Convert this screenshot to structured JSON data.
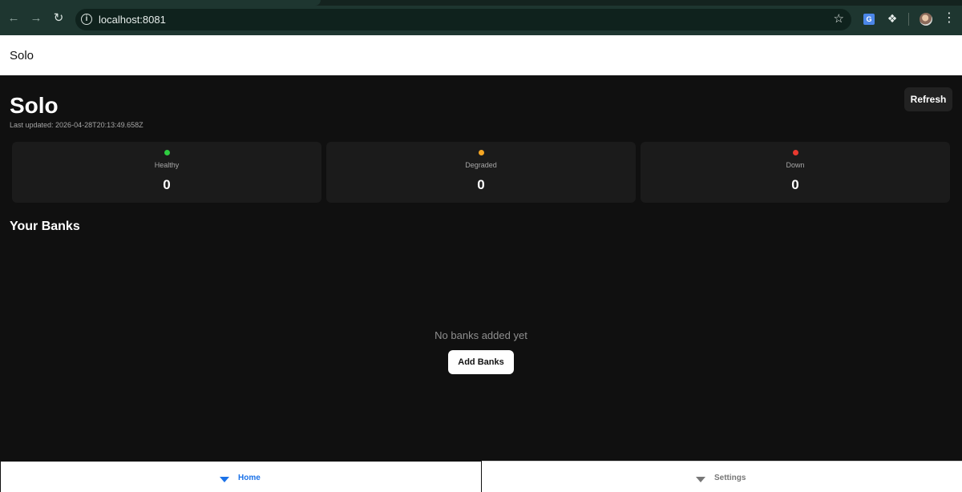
{
  "browser": {
    "url": "localhost:8081",
    "icons": {
      "back": "back-arrow-icon",
      "forward": "forward-arrow-icon",
      "reload": "reload-icon",
      "site_info": "info-icon",
      "bookmark": "star-icon",
      "translate": "translate-icon",
      "extensions": "puzzle-icon",
      "profile": "avatar",
      "menu": "more-vertical-icon"
    }
  },
  "app_header": {
    "title": "Solo"
  },
  "dashboard": {
    "title": "Solo",
    "last_updated": "Last updated: 2026-04-28T20:13:49.658Z",
    "refresh_label": "Refresh",
    "stats": [
      {
        "label": "Healthy",
        "value": "0",
        "color": "#2ecc40"
      },
      {
        "label": "Degraded",
        "value": "0",
        "color": "#f5a623"
      },
      {
        "label": "Down",
        "value": "0",
        "color": "#e8392f"
      }
    ]
  },
  "banks": {
    "title": "Your Banks",
    "empty_message": "No banks added yet",
    "add_label": "Add Banks"
  },
  "tabs": [
    {
      "label": "Home",
      "active": true,
      "color": "#1b72e8",
      "icon": "triangle-down-icon"
    },
    {
      "label": "Settings",
      "active": false,
      "color": "#777777",
      "icon": "triangle-down-icon"
    }
  ]
}
